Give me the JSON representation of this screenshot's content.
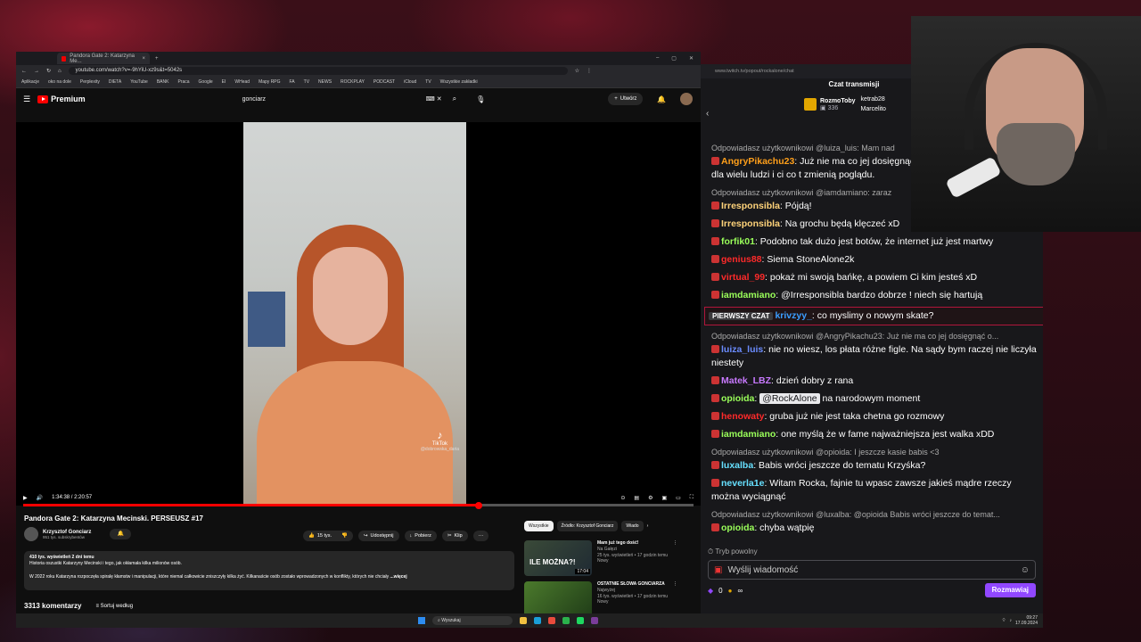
{
  "browser": {
    "tab_title": "Pandora Gate 2: Katarzyna Me...",
    "url": "youtube.com/watch?v=-9hYiU-xz9s&t=5042s",
    "bookmarks": [
      "Aplikacje",
      "oko na dole",
      "Perplexity",
      "DIETA",
      "YouTube",
      "BANK",
      "Praca",
      "Google",
      "EI",
      "WHead",
      "Mapy RPG",
      "FA",
      "TV",
      "NEWS",
      "ROCKPLAY",
      "PODCAST",
      "iCloud",
      "TV",
      "Wszystkie zakładki"
    ]
  },
  "youtube": {
    "brand": "Premium",
    "search_value": "gonciarz",
    "create_label": "Utwórz",
    "time": "1:34:38 / 2:20:57",
    "progress_fraction": 0.68,
    "video_title": "Pandora Gate 2: Katarzyna Mecinski. PERSEUSZ #17",
    "channel_name": "Krzysztof Gonciarz",
    "channel_subs": "951 tys. subskrybentów",
    "likes": "15 tys.",
    "share": "Udostępnij",
    "download": "Pobierz",
    "clip": "Klip",
    "desc_views": "410 tys. wyświetleń  2 dni temu",
    "desc_line1": "Historia oszustki Katarzyny Mecinski i tego, jak okłamała kilka milionów osób.",
    "desc_line2": "W 2022 roku Katarzyna rozpoczęła spiralę kłamstw i manipulacji, które niemal całkowicie zniszczyły kilka żyć. Kilkanaście osób zostało wprowadzonych w konflikty, których nie chciały",
    "desc_more": "...więcej",
    "comments_count": "3313 komentarzy",
    "sort_label": "Sortuj według",
    "watermark": "TikTok",
    "watermark_user": "@dobrowska_daria",
    "chips": [
      "Wszystkie",
      "Źródło: Krzysztof Gonciarz",
      "Wiado"
    ],
    "recs": [
      {
        "title": "Mam już tego dość!",
        "channel": "Na Gałęzi",
        "meta": "25 tys. wyświetleń • 17 godzin temu",
        "badge": "Nowy",
        "thumb_text": "ILE MOŻNA?!",
        "duration": "17:04"
      },
      {
        "title": "OSTATNIE SŁOWA GONCIARZA",
        "channel": "Najwyżej",
        "meta": "16 tys. wyświetleń • 17 godzin temu",
        "badge": "Nowy",
        "thumb_text": "",
        "duration": ""
      }
    ]
  },
  "chat": {
    "url": "www.twitch.tv/popout/rockalone/chat",
    "header": "Czat transmisji",
    "pinned_user": "RozmoToby",
    "pinned_count": "336",
    "gift1": "ketrab28",
    "gift2": "Marcelito",
    "messages": [
      {
        "reply": "Odpowiadasz użytkownikowi @luiza_luis: Mam nad",
        "user": "AngryPikachu23",
        "color": "#ff9f1a",
        "text": " Już nie ma co jej dosięgnąć - już zniszczoną reputację dla wielu ludzi i ci co t zmienią poglądu."
      },
      {
        "reply": "Odpowiadasz użytkownikowi @iamdamiano: zaraz",
        "user": "Irresponsibla",
        "color": "#ffd37a",
        "text": " Pójdą!"
      },
      {
        "reply": "",
        "user": "Irresponsibla",
        "color": "#ffd37a",
        "text": " Na grochu będą klęczeć xD"
      },
      {
        "reply": "",
        "user": "forfik01",
        "color": "#9aff5a",
        "text": " Podobno tak dużo jest botów, że internet już jest martwy"
      },
      {
        "reply": "",
        "user": "genius88",
        "color": "#ff2a2a",
        "text": " Siema StoneAlone2k"
      },
      {
        "reply": "",
        "user": "virtual_99",
        "color": "#ff2a2a",
        "text": " pokaż mi swoją bańkę, a powiem Ci kim jesteś xD"
      },
      {
        "reply": "",
        "user": "iamdamiano",
        "color": "#9aff5a",
        "text": " @Irresponsibla bardzo dobrze ! niech się hartują"
      }
    ],
    "first_tag": "PIERWSZY CZAT",
    "first_user": "krivzyy_",
    "first_text": " co myslimy o nowym skate?",
    "messages2": [
      {
        "reply": "Odpowiadasz użytkownikowi @AngryPikachu23: Już nie ma co jej dosięgnąć o...",
        "user": "luiza_luis",
        "color": "#6b8cff",
        "text": " nie no wiesz, los płata różne figle. Na sądy bym raczej nie liczyła niestety"
      },
      {
        "reply": "",
        "user": "Matek_LBZ",
        "color": "#c879ff",
        "text": " dzień dobry z rana"
      },
      {
        "reply": "",
        "user": "opioida",
        "color": "#9aff5a",
        "text": " ",
        "mention": "@RockAlone",
        "after": " na narodowym moment"
      },
      {
        "reply": "",
        "user": "henowaty",
        "color": "#ff2a2a",
        "text": " gruba już nie jest taka chetna go rozmowy"
      },
      {
        "reply": "",
        "user": "iamdamiano",
        "color": "#9aff5a",
        "text": " one myślą że w fame najważniejsza jest walka xDD"
      },
      {
        "reply": "Odpowiadasz użytkownikowi @opioida: I jeszcze kasie babis <3",
        "user": "luxalba",
        "color": "#66e0ff",
        "text": " Babis wróci jeszcze do tematu Krzyśka?"
      },
      {
        "reply": "",
        "user": "neverla1e",
        "color": "#66e0ff",
        "text": " Witam Rocka, fajnie tu wpasc zawsze jakieś mądre rzeczy można wyciągnąć"
      },
      {
        "reply": "Odpowiadasz użytkownikowi @luxalba: @opioida Babis wróci jeszcze do temat...",
        "user": "opioida",
        "color": "#9aff5a",
        "text": " chyba wątpię"
      }
    ],
    "slow_mode": "Tryb powolny",
    "input_placeholder": "Wyślij wiadomość",
    "points": "0",
    "send_label": "Rozmawiaj"
  },
  "taskbar": {
    "search": "Wyszukaj",
    "time": "09:27",
    "date": "17.09.2024"
  }
}
